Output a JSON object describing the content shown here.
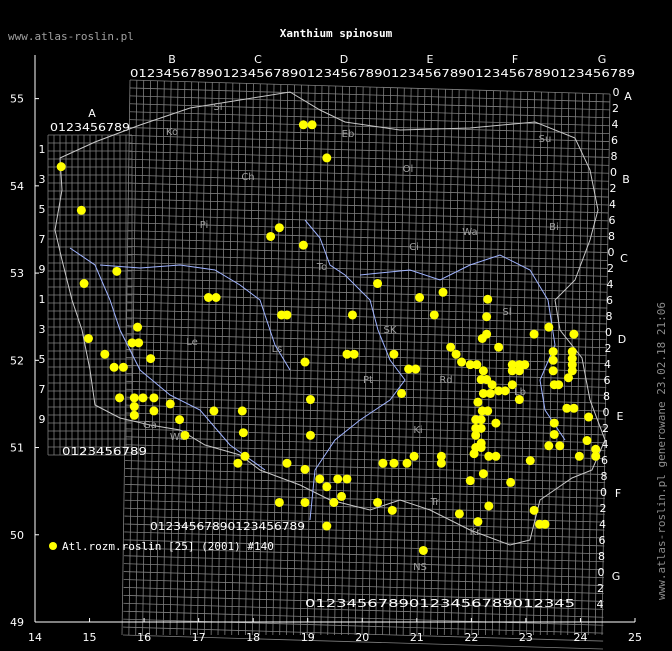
{
  "header": {
    "site": "www.atlas-roslin.pl",
    "title": "Xanthium spinosum",
    "vertical_credit": "www.atlas-roslin.pl generowane 23.02.18 21:06"
  },
  "legend": {
    "label": "Atl.rozm.roslin [25] (2001) #140",
    "color": "#ffff00"
  },
  "colors": {
    "background": "#000000",
    "grid": "#7f7f7f",
    "rivers": "#a0b4ff",
    "border": "#c8c8c8",
    "points": "#ffff00",
    "text": "#ffffff"
  },
  "axes": {
    "x_ticks": [
      "14",
      "15",
      "16",
      "17",
      "18",
      "19",
      "20",
      "21",
      "22",
      "23",
      "24",
      "25"
    ],
    "y_ticks": [
      "55",
      "54",
      "53",
      "52",
      "51",
      "50",
      "49"
    ]
  },
  "grid_letters": {
    "top": [
      "A",
      "B",
      "C",
      "D",
      "E",
      "F",
      "G"
    ],
    "right": [
      "A",
      "B",
      "C",
      "D",
      "E",
      "F",
      "G"
    ]
  },
  "grid_digits": "0123456789",
  "regions": [
    "Sl",
    "Ko",
    "Eb",
    "Su",
    "Ch",
    "Ol",
    "Pi",
    "Bi",
    "To",
    "Ci",
    "Wa",
    "Ls",
    "Le",
    "SK",
    "Sl",
    "Pt",
    "Rd",
    "Lb",
    "Ki",
    "Wb",
    "Tr",
    "NS",
    "Kr",
    "Ga"
  ],
  "chart_data": {
    "type": "scatter",
    "xlim": [
      14,
      25
    ],
    "ylim": [
      49,
      55.5
    ],
    "points": [
      [
        14.48,
        54.22
      ],
      [
        14.85,
        53.72
      ],
      [
        14.9,
        52.88
      ],
      [
        14.98,
        52.25
      ],
      [
        15.5,
        53.02
      ],
      [
        15.28,
        52.07
      ],
      [
        15.45,
        51.92
      ],
      [
        15.62,
        51.92
      ],
      [
        15.88,
        52.38
      ],
      [
        15.78,
        52.2
      ],
      [
        15.9,
        52.2
      ],
      [
        16.12,
        52.02
      ],
      [
        15.55,
        51.57
      ],
      [
        15.82,
        51.57
      ],
      [
        15.82,
        51.47
      ],
      [
        15.82,
        51.37
      ],
      [
        15.98,
        51.57
      ],
      [
        16.18,
        51.57
      ],
      [
        16.18,
        51.42
      ],
      [
        16.48,
        51.5
      ],
      [
        16.65,
        51.32
      ],
      [
        16.75,
        51.14
      ],
      [
        17.28,
        51.42
      ],
      [
        17.18,
        52.72
      ],
      [
        17.32,
        52.72
      ],
      [
        17.8,
        51.42
      ],
      [
        17.82,
        51.17
      ],
      [
        17.85,
        50.9
      ],
      [
        17.72,
        50.82
      ],
      [
        18.32,
        53.42
      ],
      [
        18.48,
        53.52
      ],
      [
        18.52,
        52.52
      ],
      [
        18.62,
        52.52
      ],
      [
        18.92,
        53.32
      ],
      [
        18.92,
        54.7
      ],
      [
        19.08,
        54.7
      ],
      [
        19.35,
        54.32
      ],
      [
        18.95,
        51.98
      ],
      [
        19.72,
        52.07
      ],
      [
        19.85,
        52.07
      ],
      [
        19.82,
        52.52
      ],
      [
        19.05,
        51.55
      ],
      [
        19.05,
        51.14
      ],
      [
        18.62,
        50.82
      ],
      [
        18.48,
        50.37
      ],
      [
        18.95,
        50.75
      ],
      [
        18.95,
        50.37
      ],
      [
        19.22,
        50.64
      ],
      [
        19.35,
        50.55
      ],
      [
        19.55,
        50.64
      ],
      [
        19.48,
        50.37
      ],
      [
        19.62,
        50.44
      ],
      [
        19.72,
        50.64
      ],
      [
        19.35,
        50.1
      ],
      [
        20.28,
        52.88
      ],
      [
        20.58,
        52.07
      ],
      [
        20.72,
        51.62
      ],
      [
        20.85,
        51.9
      ],
      [
        20.98,
        51.9
      ],
      [
        21.05,
        52.72
      ],
      [
        21.32,
        52.52
      ],
      [
        21.48,
        52.78
      ],
      [
        20.38,
        50.82
      ],
      [
        20.58,
        50.82
      ],
      [
        20.82,
        50.82
      ],
      [
        20.95,
        50.9
      ],
      [
        21.45,
        50.9
      ],
      [
        21.45,
        50.82
      ],
      [
        20.28,
        50.37
      ],
      [
        20.55,
        50.28
      ],
      [
        21.62,
        52.15
      ],
      [
        21.72,
        52.07
      ],
      [
        21.82,
        51.98
      ],
      [
        21.98,
        51.95
      ],
      [
        22.1,
        51.95
      ],
      [
        22.22,
        51.88
      ],
      [
        22.18,
        51.78
      ],
      [
        22.28,
        51.78
      ],
      [
        22.38,
        51.72
      ],
      [
        22.22,
        51.62
      ],
      [
        22.35,
        51.62
      ],
      [
        22.5,
        51.65
      ],
      [
        22.62,
        51.65
      ],
      [
        22.12,
        51.52
      ],
      [
        22.2,
        51.42
      ],
      [
        22.3,
        51.42
      ],
      [
        22.08,
        51.32
      ],
      [
        22.18,
        51.32
      ],
      [
        22.08,
        51.22
      ],
      [
        22.18,
        51.22
      ],
      [
        22.08,
        51.14
      ],
      [
        22.18,
        51.05
      ],
      [
        22.08,
        51.0
      ],
      [
        22.18,
        51.0
      ],
      [
        22.05,
        50.93
      ],
      [
        22.32,
        50.9
      ],
      [
        22.45,
        50.9
      ],
      [
        22.45,
        51.28
      ],
      [
        22.2,
        52.25
      ],
      [
        22.28,
        52.5
      ],
      [
        22.28,
        52.3
      ],
      [
        22.3,
        52.7
      ],
      [
        22.5,
        52.15
      ],
      [
        22.75,
        51.95
      ],
      [
        22.75,
        51.88
      ],
      [
        22.88,
        51.95
      ],
      [
        22.88,
        51.88
      ],
      [
        22.75,
        51.72
      ],
      [
        22.98,
        51.95
      ],
      [
        22.88,
        51.55
      ],
      [
        23.15,
        52.3
      ],
      [
        23.42,
        52.38
      ],
      [
        23.5,
        52.1
      ],
      [
        23.5,
        52.0
      ],
      [
        23.5,
        51.88
      ],
      [
        23.52,
        51.72
      ],
      [
        23.6,
        51.72
      ],
      [
        23.78,
        51.8
      ],
      [
        23.88,
        52.3
      ],
      [
        23.85,
        52.1
      ],
      [
        23.85,
        52.02
      ],
      [
        23.85,
        51.95
      ],
      [
        23.85,
        51.88
      ],
      [
        23.52,
        51.28
      ],
      [
        23.52,
        51.15
      ],
      [
        23.42,
        51.02
      ],
      [
        23.62,
        51.02
      ],
      [
        23.75,
        51.45
      ],
      [
        23.88,
        51.45
      ],
      [
        24.15,
        51.35
      ],
      [
        24.12,
        51.08
      ],
      [
        24.28,
        50.98
      ],
      [
        24.28,
        50.9
      ],
      [
        23.98,
        50.9
      ],
      [
        23.08,
        50.85
      ],
      [
        22.72,
        50.6
      ],
      [
        22.22,
        50.7
      ],
      [
        21.98,
        50.62
      ],
      [
        22.32,
        50.33
      ],
      [
        22.12,
        50.15
      ],
      [
        21.78,
        50.24
      ],
      [
        21.12,
        49.82
      ],
      [
        23.15,
        50.28
      ],
      [
        23.25,
        50.12
      ],
      [
        23.35,
        50.12
      ]
    ]
  }
}
